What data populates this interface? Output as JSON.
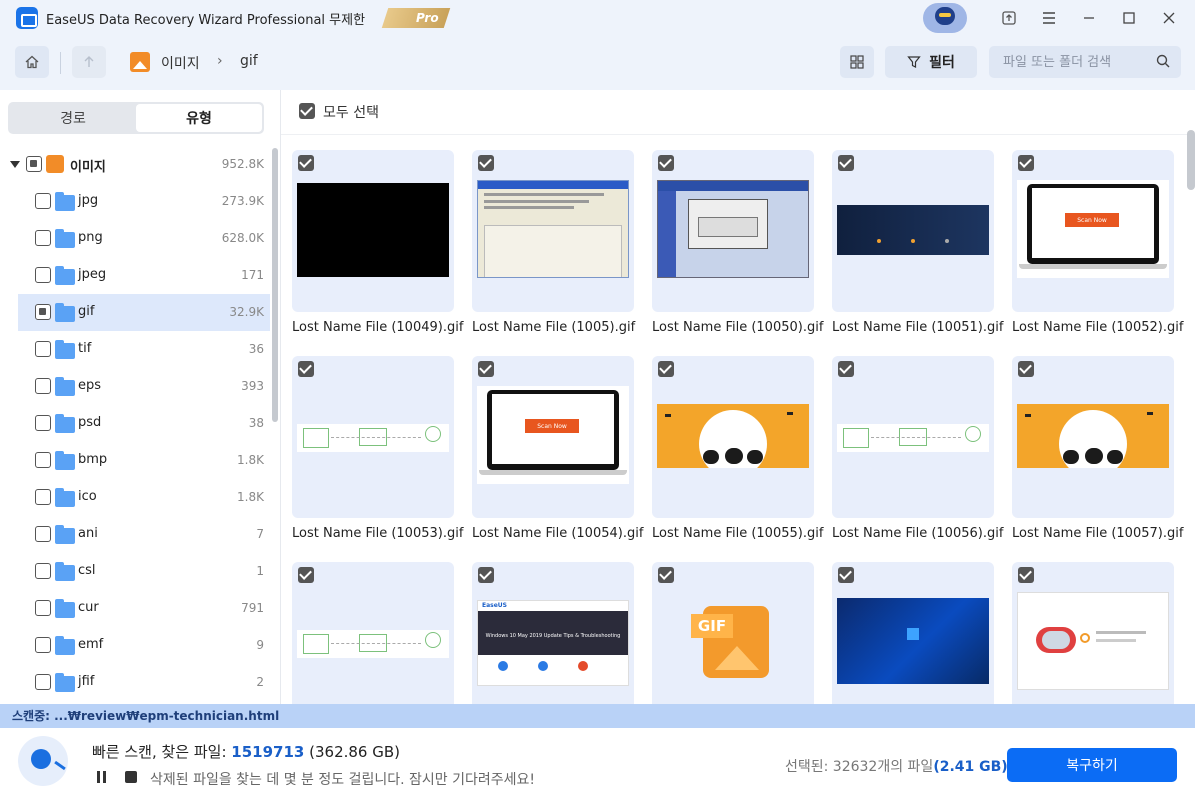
{
  "window": {
    "title": "EaseUS Data Recovery Wizard Professional 무제한",
    "badge": "Pro"
  },
  "toolbar": {
    "breadcrumb": [
      "이미지",
      "gif"
    ],
    "filter_label": "필터",
    "search_placeholder": "파일 또는 폴더 검색"
  },
  "sidebar": {
    "tabs": [
      "경로",
      "유형"
    ],
    "active_tab": "유형",
    "root": {
      "label": "이미지",
      "count": "952.8K"
    },
    "items": [
      {
        "label": "jpg",
        "count": "273.9K"
      },
      {
        "label": "png",
        "count": "628.0K"
      },
      {
        "label": "jpeg",
        "count": "171"
      },
      {
        "label": "gif",
        "count": "32.9K"
      },
      {
        "label": "tif",
        "count": "36"
      },
      {
        "label": "eps",
        "count": "393"
      },
      {
        "label": "psd",
        "count": "38"
      },
      {
        "label": "bmp",
        "count": "1.8K"
      },
      {
        "label": "ico",
        "count": "1.8K"
      },
      {
        "label": "ani",
        "count": "7"
      },
      {
        "label": "csl",
        "count": "1"
      },
      {
        "label": "cur",
        "count": "791"
      },
      {
        "label": "emf",
        "count": "9"
      },
      {
        "label": "jfif",
        "count": "2"
      }
    ],
    "selected_item": "gif"
  },
  "content": {
    "select_all_label": "모두 선택",
    "files": [
      {
        "name": "Lost Name File (10049).gif",
        "thumb": "black"
      },
      {
        "name": "Lost Name File (1005).gif",
        "thumb": "dialog"
      },
      {
        "name": "Lost Name File (10050).gif",
        "thumb": "window"
      },
      {
        "name": "Lost Name File (10051).gif",
        "thumb": "darkblue"
      },
      {
        "name": "Lost Name File (10052).gif",
        "thumb": "laptop"
      },
      {
        "name": "Lost Name File (10053).gif",
        "thumb": "diagram"
      },
      {
        "name": "Lost Name File (10054).gif",
        "thumb": "laptop"
      },
      {
        "name": "Lost Name File (10055).gif",
        "thumb": "halloween"
      },
      {
        "name": "Lost Name File (10056).gif",
        "thumb": "diagram"
      },
      {
        "name": "Lost Name File (10057).gif",
        "thumb": "halloween"
      },
      {
        "name": "",
        "thumb": "diagram"
      },
      {
        "name": "",
        "thumb": "webpage"
      },
      {
        "name": "",
        "thumb": "gif-icon"
      },
      {
        "name": "",
        "thumb": "win-desktop"
      },
      {
        "name": "",
        "thumb": "disk-app"
      }
    ],
    "thumb_text": {
      "laptop_button": "Scan Now",
      "gif_icon": "GIF",
      "webpage_logo": "EaseUS",
      "webpage_headline": "Windows 10 May 2019 Update Tips & Troubleshooting"
    }
  },
  "status": {
    "scanning_path": "스캔중: ...₩review₩epm-technician.html",
    "scan_title": "빠른 스캔, 찾은 파일: ",
    "found_count": "1519713",
    "found_size": "(362.86 GB)",
    "hint": "삭제된 파일을 찾는 데 몇 분 정도 걸립니다. 잠시만 기다려주세요!",
    "selected_prefix": "선택된: 32632개의 파일",
    "selected_size": "(2.41 GB)",
    "recover_label": "복구하기"
  },
  "colors": {
    "accent": "#0b6cf5",
    "titlebar_bg": "#eef3fb",
    "card_bg": "#e8eefb",
    "status_strip": "#b9d2f7",
    "folder": "#5aa2f5",
    "image_icon": "#f28c28"
  },
  "icons": {
    "home": "home-icon",
    "up": "arrow-up-icon",
    "grid": "grid-view-icon",
    "filter": "filter-icon",
    "search": "search-icon",
    "upload": "upload-icon",
    "menu": "menu-icon"
  }
}
